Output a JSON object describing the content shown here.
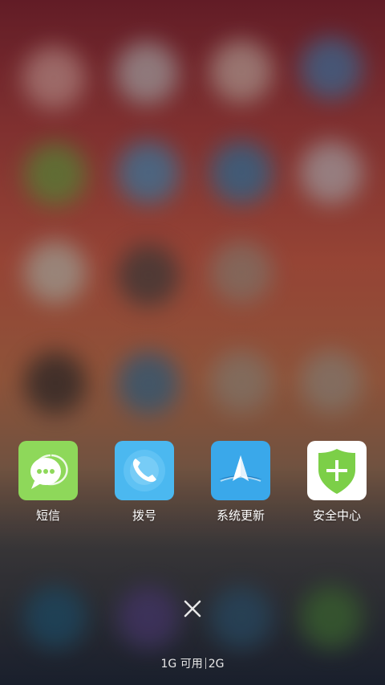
{
  "apps": [
    {
      "label": "短信",
      "icon": "sms-icon",
      "color": "#8ed85a"
    },
    {
      "label": "拨号",
      "icon": "phone-icon",
      "color": "#4bb8f0"
    },
    {
      "label": "系统更新",
      "icon": "system-update-icon",
      "color": "#3aa8ea"
    },
    {
      "label": "安全中心",
      "icon": "security-center-icon",
      "color": "#ffffff"
    }
  ],
  "close_icon": "close-icon",
  "memory": {
    "used": "1G 可用",
    "total": "2G"
  }
}
